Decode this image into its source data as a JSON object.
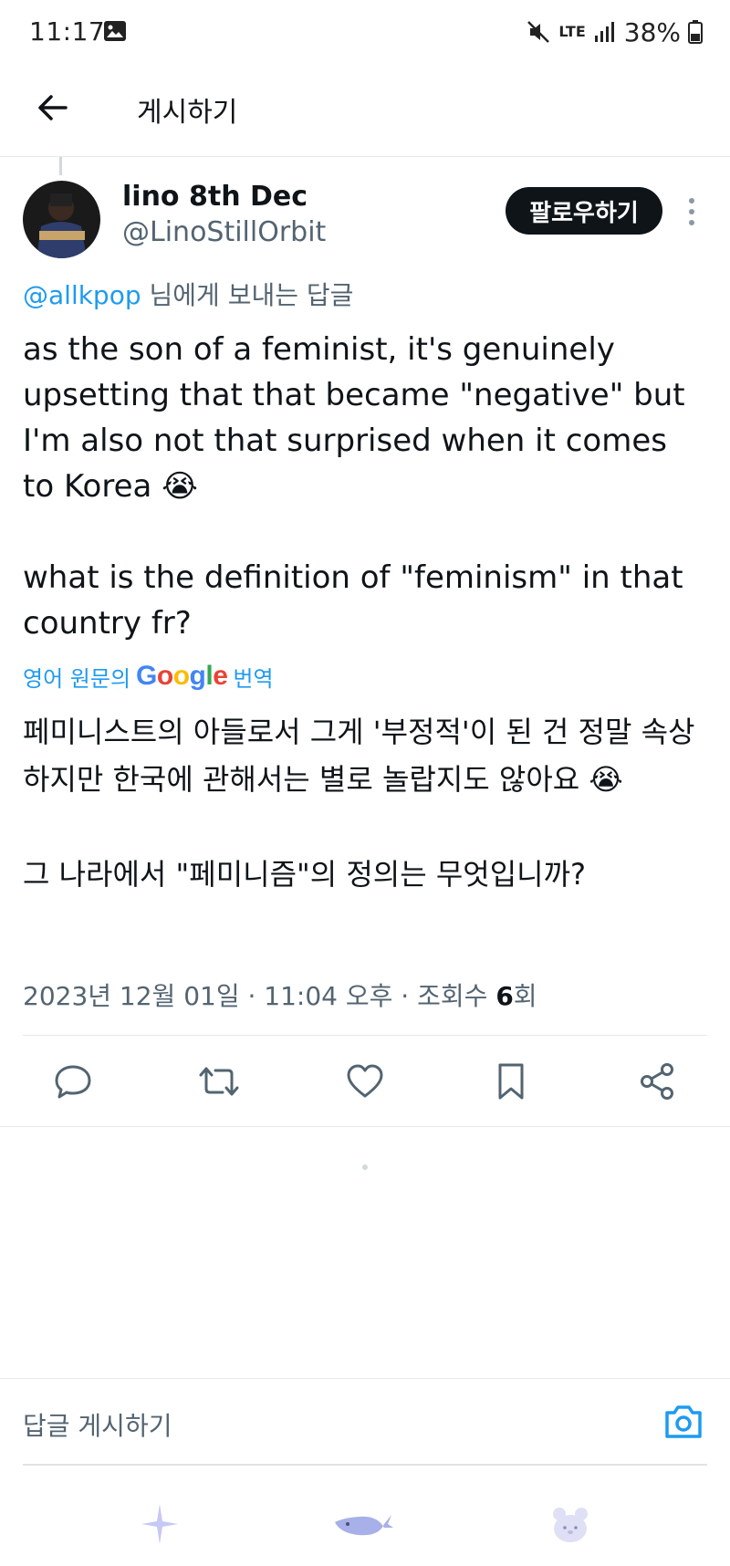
{
  "status_bar": {
    "time": "11:17",
    "battery": "38%",
    "network": "LTE",
    "icons": [
      "image-icon",
      "mute-icon",
      "lte-icon",
      "signal-icon",
      "battery-icon"
    ]
  },
  "header": {
    "title": "게시하기",
    "back_icon": "arrow-left-icon"
  },
  "tweet": {
    "display_name": "lino 8th Dec",
    "handle": "@LinoStillOrbit",
    "follow_label": "팔로우하기",
    "reply_to_mention": "@allkpop",
    "reply_to_suffix": " 님에게 보내는 답글",
    "text": "as the son of a feminist, it's genuinely upsetting that that became \"negative\" but I'm also not that surprised when it comes to Korea 😭\n\nwhat is the definition of \"feminism\" in that country fr?",
    "translation_label_prefix": "영어 원문의",
    "translation_label_suffix": "번역",
    "google": [
      "G",
      "o",
      "o",
      "g",
      "l",
      "e"
    ],
    "translated_text": "페미니스트의 아들로서 그게 '부정적'이 된 건 정말 속상하지만 한국에 관해서는 별로 놀랍지도 않아요 😭\n\n그 나라에서 \"페미니즘\"의 정의는 무엇입니까?",
    "timestamp": "2023년 12월 01일 · 11:04 오후 · 조회수",
    "views": "6",
    "views_suffix": "회"
  },
  "actions": [
    "reply-icon",
    "retweet-icon",
    "like-icon",
    "bookmark-icon",
    "share-icon"
  ],
  "reply_bar": {
    "placeholder": "답글 게시하기",
    "camera_icon": "camera-icon"
  },
  "bottom_nav": [
    "sparkle-icon",
    "whale-icon",
    "bear-icon"
  ],
  "colors": {
    "accent": "#1d9bf0",
    "text": "#0f1419",
    "secondary": "#536471",
    "follow_bg": "#0f1419"
  }
}
